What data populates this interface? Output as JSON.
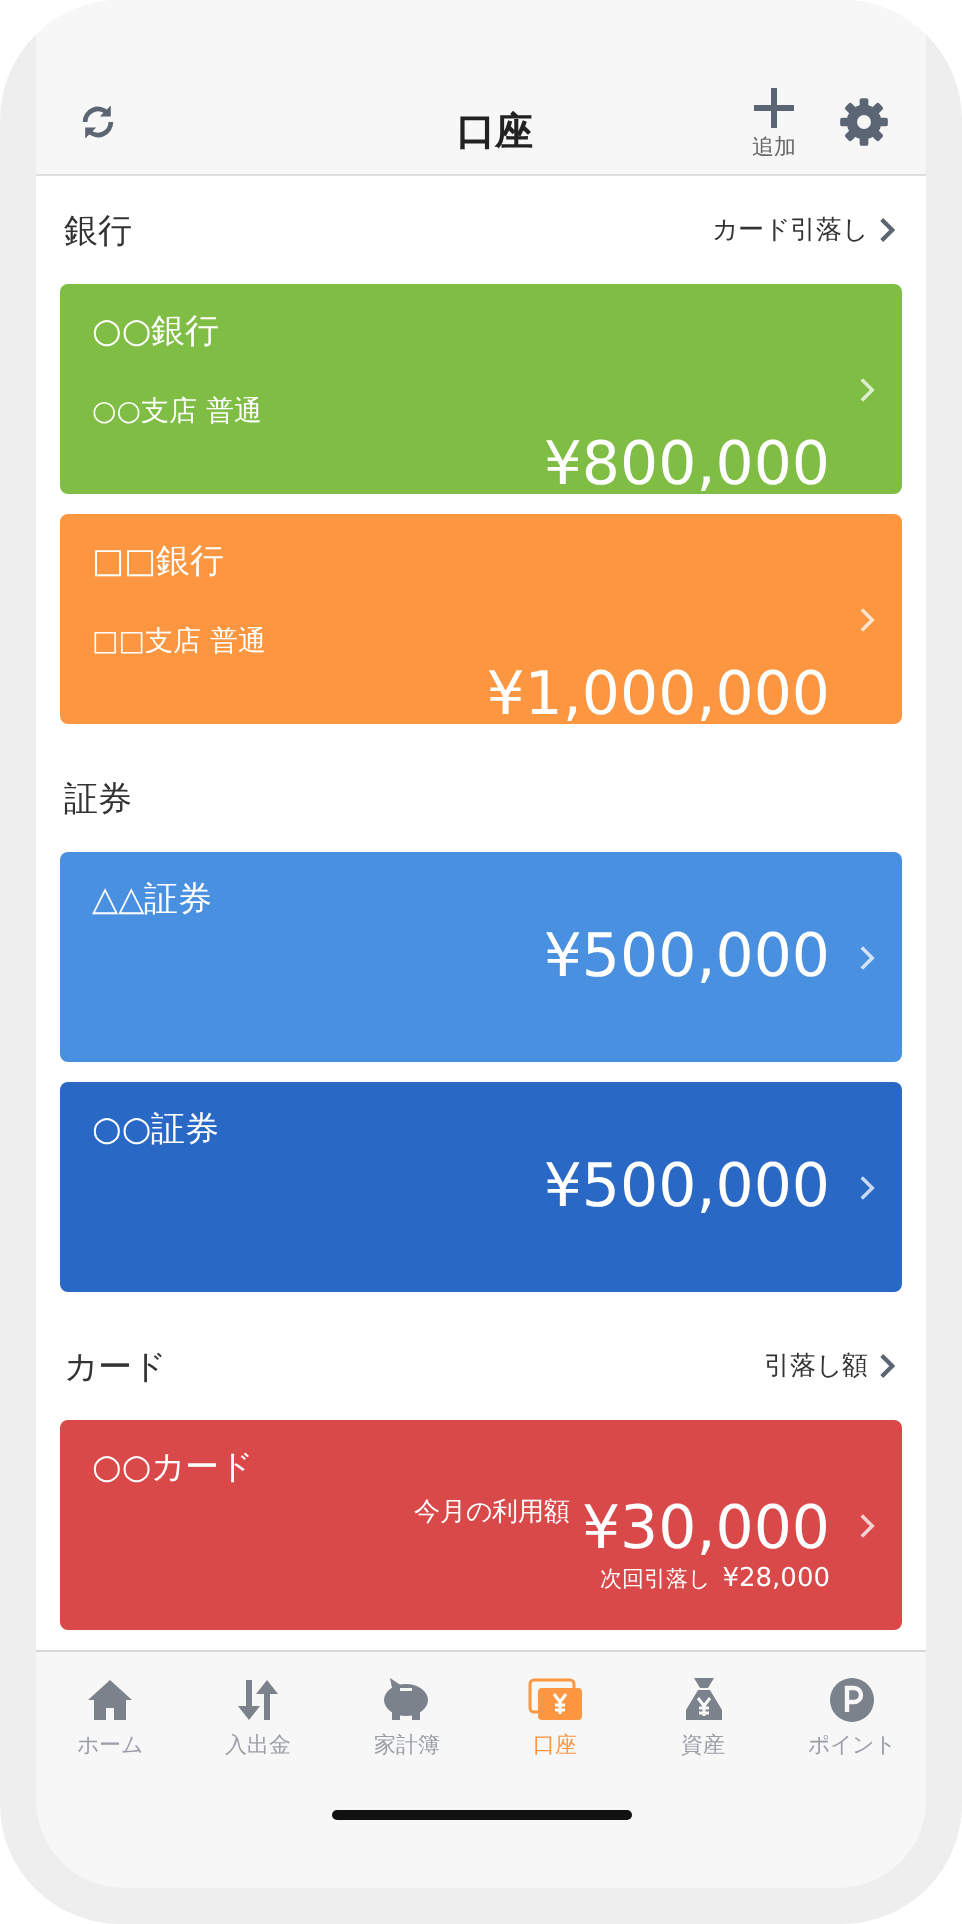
{
  "header": {
    "title": "口座",
    "add_label": "追加"
  },
  "sections": [
    {
      "title": "銀行",
      "link": "カード引落し",
      "accounts": [
        {
          "kind": "bank",
          "name": "○○銀行",
          "branch": "○○支店 普通",
          "amount": "¥800,000",
          "color": "#80bd45"
        },
        {
          "kind": "bank",
          "name": "□□銀行",
          "branch": "□□支店 普通",
          "amount": "¥1,000,000",
          "color": "#fd9641"
        }
      ]
    },
    {
      "title": "証券",
      "accounts": [
        {
          "kind": "securities",
          "name": "△△証券",
          "amount": "¥500,000",
          "color": "#4a90e0"
        },
        {
          "kind": "securities",
          "name": "○○証券",
          "amount": "¥500,000",
          "color": "#2a68c6"
        }
      ]
    },
    {
      "title": "カード",
      "link": "引落し額",
      "accounts": [
        {
          "kind": "card",
          "name": "○○カード",
          "usage_label": "今月の利用額",
          "amount": "¥30,000",
          "next_label": "次回引落し",
          "next_amount": "¥28,000",
          "color": "#d9494a"
        }
      ]
    }
  ],
  "tabs": [
    {
      "label": "ホーム",
      "selected": false
    },
    {
      "label": "入出金",
      "selected": false
    },
    {
      "label": "家計簿",
      "selected": false
    },
    {
      "label": "口座",
      "selected": true
    },
    {
      "label": "資産",
      "selected": false
    },
    {
      "label": "ポイント",
      "selected": false
    }
  ]
}
